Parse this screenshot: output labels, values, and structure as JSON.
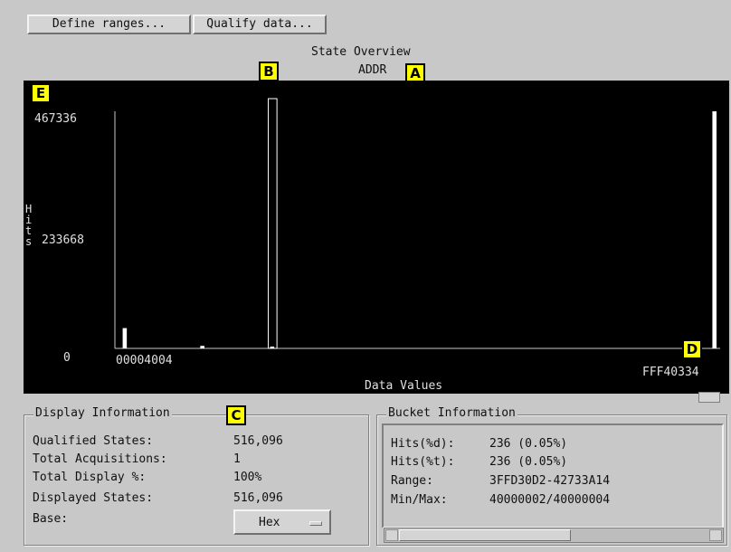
{
  "toolbar": {
    "define_ranges_label": "Define ranges...",
    "qualify_data_label": "Qualify data..."
  },
  "chart_title": "State Overview",
  "chart_subtitle": "ADDR",
  "callouts": {
    "a": "A",
    "b": "B",
    "c": "C",
    "d": "D",
    "e": "E"
  },
  "chart_data": {
    "type": "bar",
    "title": "State Overview",
    "subtitle": "ADDR",
    "ylabel": "Hits",
    "xlabel": "Data Values",
    "y_ticks": [
      "467336",
      "233668",
      "0"
    ],
    "ylim": [
      0,
      467336
    ],
    "x_range_labels": [
      "00004004",
      "FFF40334"
    ],
    "grid": false,
    "bars": [
      {
        "bucket": 1,
        "value": 40000,
        "selected": false
      },
      {
        "bucket": 11,
        "value": 5000,
        "selected": false
      },
      {
        "bucket": 20,
        "value": 2000,
        "selected": true
      },
      {
        "bucket": 77,
        "value": 467336,
        "selected": false
      }
    ],
    "bucket_count": 78,
    "colors": {
      "background": "#000000",
      "bar": "#ffffff",
      "axis": "#c8c8c8"
    }
  },
  "display_info": {
    "legend": "Display Information",
    "rows": [
      {
        "label": "Qualified States:",
        "value": "516,096"
      },
      {
        "label": "Total Acquisitions:",
        "value": "1"
      },
      {
        "label": "Total Display %:",
        "value": "100%"
      },
      {
        "label": "Displayed States:",
        "value": "516,096"
      },
      {
        "label": "Base:",
        "value": ""
      }
    ],
    "base_select": "Hex"
  },
  "bucket_info": {
    "legend": "Bucket Information",
    "rows": [
      {
        "label": "Hits(%d):",
        "value": "236 (0.05%)"
      },
      {
        "label": "Hits(%t):",
        "value": "236 (0.05%)"
      },
      {
        "label": "Range:",
        "value": "3FFD30D2-42733A14"
      },
      {
        "label": "Min/Max:",
        "value": "40000002/40000004"
      }
    ]
  }
}
